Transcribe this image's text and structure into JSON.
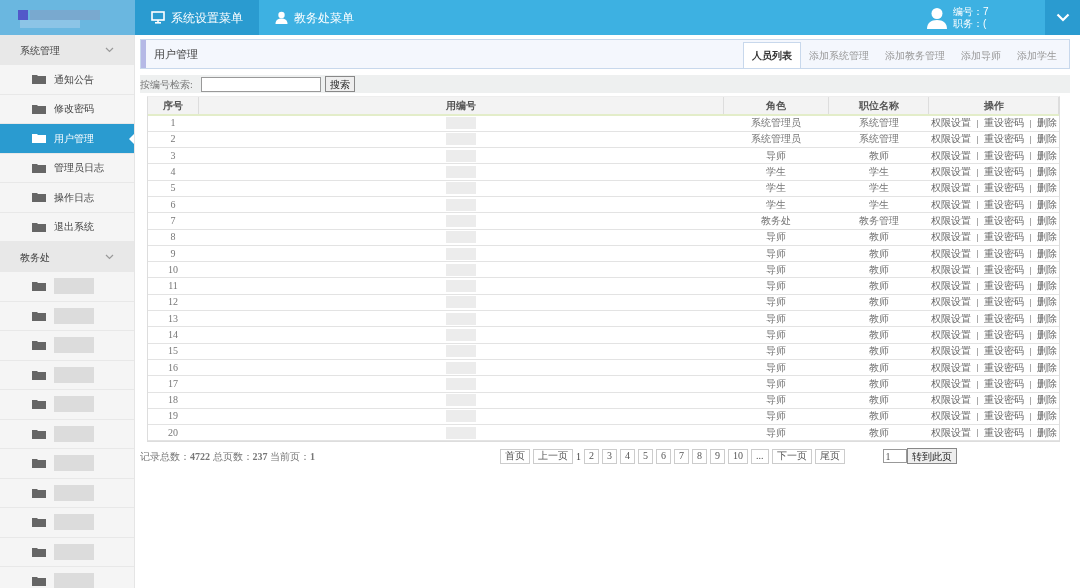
{
  "top_menu": [
    {
      "label": "系统设置菜单",
      "selected": true
    },
    {
      "label": "教务处菜单",
      "selected": false
    }
  ],
  "user_info": {
    "id_label": "编号：7",
    "role_label": "职务：("
  },
  "sidebar": [
    {
      "label": "系统管理",
      "expanded": true,
      "children": [
        {
          "label": "通知公告",
          "selected": false
        },
        {
          "label": "修改密码",
          "selected": false
        },
        {
          "label": "用户管理",
          "selected": true
        },
        {
          "label": "管理员日志",
          "selected": false
        },
        {
          "label": "操作日志",
          "selected": false
        },
        {
          "label": "退出系统",
          "selected": false
        }
      ]
    },
    {
      "label": "教务处",
      "expanded": true,
      "children": [
        {
          "kind": "redacted",
          "selected": false
        },
        {
          "kind": "redacted",
          "selected": false
        },
        {
          "kind": "redacted",
          "selected": false
        },
        {
          "kind": "redacted",
          "selected": false
        },
        {
          "kind": "redacted",
          "selected": false
        },
        {
          "kind": "redacted",
          "selected": false
        },
        {
          "kind": "redacted",
          "selected": false
        },
        {
          "kind": "redacted",
          "selected": false
        },
        {
          "kind": "redacted",
          "selected": false
        },
        {
          "kind": "redacted",
          "selected": false
        },
        {
          "kind": "redacted",
          "selected": false
        }
      ]
    }
  ],
  "page_title": "用户管理",
  "tabs": [
    {
      "label": "人员列表",
      "selected": true
    },
    {
      "label": "添加系统管理",
      "selected": false
    },
    {
      "label": "添加教务管理",
      "selected": false
    },
    {
      "label": "添加导师",
      "selected": false
    },
    {
      "label": "添加学生",
      "selected": false
    }
  ],
  "search": {
    "label": "按编号检索:",
    "button": "搜索"
  },
  "table": {
    "columns": [
      "序号",
      "用编号",
      "角色",
      "职位名称",
      "操作"
    ],
    "rows": [
      {
        "no": "1",
        "role": "系统管理员",
        "position": "系统管理",
        "actions": [
          "权限设置",
          "重设密码",
          "删除"
        ]
      },
      {
        "no": "2",
        "role": "系统管理员",
        "position": "系统管理",
        "actions": [
          "权限设置",
          "重设密码",
          "删除"
        ]
      },
      {
        "no": "3",
        "role": "导师",
        "position": "教师",
        "actions": [
          "权限设置",
          "重设密码",
          "删除"
        ]
      },
      {
        "no": "4",
        "role": "学生",
        "position": "学生",
        "actions": [
          "权限设置",
          "重设密码",
          "删除"
        ]
      },
      {
        "no": "5",
        "role": "学生",
        "position": "学生",
        "actions": [
          "权限设置",
          "重设密码",
          "删除"
        ]
      },
      {
        "no": "6",
        "role": "学生",
        "position": "学生",
        "actions": [
          "权限设置",
          "重设密码",
          "删除"
        ]
      },
      {
        "no": "7",
        "role": "教务处",
        "position": "教务管理",
        "actions": [
          "权限设置",
          "重设密码",
          "删除"
        ]
      },
      {
        "no": "8",
        "role": "导师",
        "position": "教师",
        "actions": [
          "权限设置",
          "重设密码",
          "删除"
        ]
      },
      {
        "no": "9",
        "role": "导师",
        "position": "教师",
        "actions": [
          "权限设置",
          "重设密码",
          "删除"
        ]
      },
      {
        "no": "10",
        "role": "导师",
        "position": "教师",
        "actions": [
          "权限设置",
          "重设密码",
          "删除"
        ]
      },
      {
        "no": "11",
        "role": "导师",
        "position": "教师",
        "actions": [
          "权限设置",
          "重设密码",
          "删除"
        ]
      },
      {
        "no": "12",
        "role": "导师",
        "position": "教师",
        "actions": [
          "权限设置",
          "重设密码",
          "删除"
        ]
      },
      {
        "no": "13",
        "role": "导师",
        "position": "教师",
        "actions": [
          "权限设置",
          "重设密码",
          "删除"
        ]
      },
      {
        "no": "14",
        "role": "导师",
        "position": "教师",
        "actions": [
          "权限设置",
          "重设密码",
          "删除"
        ]
      },
      {
        "no": "15",
        "role": "导师",
        "position": "教师",
        "actions": [
          "权限设置",
          "重设密码",
          "删除"
        ]
      },
      {
        "no": "16",
        "role": "导师",
        "position": "教师",
        "actions": [
          "权限设置",
          "重设密码",
          "删除"
        ]
      },
      {
        "no": "17",
        "role": "导师",
        "position": "教师",
        "actions": [
          "权限设置",
          "重设密码",
          "删除"
        ]
      },
      {
        "no": "18",
        "role": "导师",
        "position": "教师",
        "actions": [
          "权限设置",
          "重设密码",
          "删除"
        ]
      },
      {
        "no": "19",
        "role": "导师",
        "position": "教师",
        "actions": [
          "权限设置",
          "重设密码",
          "删除"
        ]
      },
      {
        "no": "20",
        "role": "导师",
        "position": "教师",
        "actions": [
          "权限设置",
          "重设密码",
          "删除"
        ]
      }
    ]
  },
  "footer": {
    "summary": "记录总数：**4722** 总页数：**237** 当前页：**1**",
    "pager": [
      {
        "label": "首页",
        "kind": "button"
      },
      {
        "label": "上一页",
        "kind": "button"
      },
      {
        "label": "1",
        "kind": "current"
      },
      {
        "label": "2",
        "kind": "button"
      },
      {
        "label": "3",
        "kind": "button"
      },
      {
        "label": "4",
        "kind": "button"
      },
      {
        "label": "5",
        "kind": "button"
      },
      {
        "label": "6",
        "kind": "button"
      },
      {
        "label": "7",
        "kind": "button"
      },
      {
        "label": "8",
        "kind": "button"
      },
      {
        "label": "9",
        "kind": "button"
      },
      {
        "label": "10",
        "kind": "button"
      },
      {
        "label": "...",
        "kind": "button"
      },
      {
        "label": "下一页",
        "kind": "button"
      },
      {
        "label": "尾页",
        "kind": "button"
      }
    ],
    "page_input": "1",
    "goto_button": "转到此页"
  }
}
